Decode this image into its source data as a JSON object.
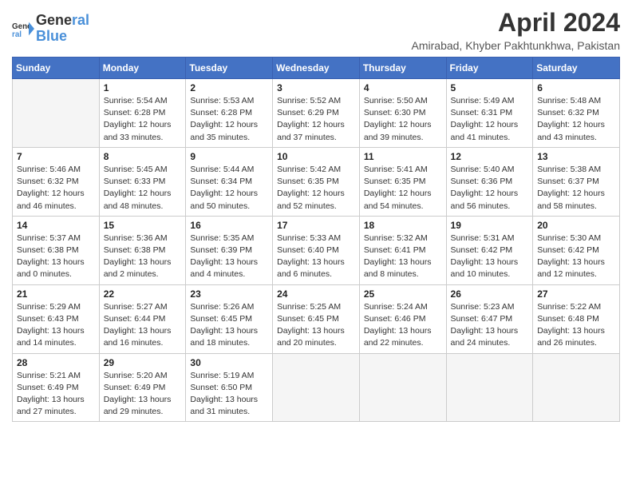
{
  "logo": {
    "line1": "General",
    "line2": "Blue"
  },
  "title": "April 2024",
  "subtitle": "Amirabad, Khyber Pakhtunkhwa, Pakistan",
  "weekdays": [
    "Sunday",
    "Monday",
    "Tuesday",
    "Wednesday",
    "Thursday",
    "Friday",
    "Saturday"
  ],
  "weeks": [
    [
      {
        "day": "",
        "sunrise": "",
        "sunset": "",
        "daylight": ""
      },
      {
        "day": "1",
        "sunrise": "Sunrise: 5:54 AM",
        "sunset": "Sunset: 6:28 PM",
        "daylight": "Daylight: 12 hours and 33 minutes."
      },
      {
        "day": "2",
        "sunrise": "Sunrise: 5:53 AM",
        "sunset": "Sunset: 6:28 PM",
        "daylight": "Daylight: 12 hours and 35 minutes."
      },
      {
        "day": "3",
        "sunrise": "Sunrise: 5:52 AM",
        "sunset": "Sunset: 6:29 PM",
        "daylight": "Daylight: 12 hours and 37 minutes."
      },
      {
        "day": "4",
        "sunrise": "Sunrise: 5:50 AM",
        "sunset": "Sunset: 6:30 PM",
        "daylight": "Daylight: 12 hours and 39 minutes."
      },
      {
        "day": "5",
        "sunrise": "Sunrise: 5:49 AM",
        "sunset": "Sunset: 6:31 PM",
        "daylight": "Daylight: 12 hours and 41 minutes."
      },
      {
        "day": "6",
        "sunrise": "Sunrise: 5:48 AM",
        "sunset": "Sunset: 6:32 PM",
        "daylight": "Daylight: 12 hours and 43 minutes."
      }
    ],
    [
      {
        "day": "7",
        "sunrise": "Sunrise: 5:46 AM",
        "sunset": "Sunset: 6:32 PM",
        "daylight": "Daylight: 12 hours and 46 minutes."
      },
      {
        "day": "8",
        "sunrise": "Sunrise: 5:45 AM",
        "sunset": "Sunset: 6:33 PM",
        "daylight": "Daylight: 12 hours and 48 minutes."
      },
      {
        "day": "9",
        "sunrise": "Sunrise: 5:44 AM",
        "sunset": "Sunset: 6:34 PM",
        "daylight": "Daylight: 12 hours and 50 minutes."
      },
      {
        "day": "10",
        "sunrise": "Sunrise: 5:42 AM",
        "sunset": "Sunset: 6:35 PM",
        "daylight": "Daylight: 12 hours and 52 minutes."
      },
      {
        "day": "11",
        "sunrise": "Sunrise: 5:41 AM",
        "sunset": "Sunset: 6:35 PM",
        "daylight": "Daylight: 12 hours and 54 minutes."
      },
      {
        "day": "12",
        "sunrise": "Sunrise: 5:40 AM",
        "sunset": "Sunset: 6:36 PM",
        "daylight": "Daylight: 12 hours and 56 minutes."
      },
      {
        "day": "13",
        "sunrise": "Sunrise: 5:38 AM",
        "sunset": "Sunset: 6:37 PM",
        "daylight": "Daylight: 12 hours and 58 minutes."
      }
    ],
    [
      {
        "day": "14",
        "sunrise": "Sunrise: 5:37 AM",
        "sunset": "Sunset: 6:38 PM",
        "daylight": "Daylight: 13 hours and 0 minutes."
      },
      {
        "day": "15",
        "sunrise": "Sunrise: 5:36 AM",
        "sunset": "Sunset: 6:38 PM",
        "daylight": "Daylight: 13 hours and 2 minutes."
      },
      {
        "day": "16",
        "sunrise": "Sunrise: 5:35 AM",
        "sunset": "Sunset: 6:39 PM",
        "daylight": "Daylight: 13 hours and 4 minutes."
      },
      {
        "day": "17",
        "sunrise": "Sunrise: 5:33 AM",
        "sunset": "Sunset: 6:40 PM",
        "daylight": "Daylight: 13 hours and 6 minutes."
      },
      {
        "day": "18",
        "sunrise": "Sunrise: 5:32 AM",
        "sunset": "Sunset: 6:41 PM",
        "daylight": "Daylight: 13 hours and 8 minutes."
      },
      {
        "day": "19",
        "sunrise": "Sunrise: 5:31 AM",
        "sunset": "Sunset: 6:42 PM",
        "daylight": "Daylight: 13 hours and 10 minutes."
      },
      {
        "day": "20",
        "sunrise": "Sunrise: 5:30 AM",
        "sunset": "Sunset: 6:42 PM",
        "daylight": "Daylight: 13 hours and 12 minutes."
      }
    ],
    [
      {
        "day": "21",
        "sunrise": "Sunrise: 5:29 AM",
        "sunset": "Sunset: 6:43 PM",
        "daylight": "Daylight: 13 hours and 14 minutes."
      },
      {
        "day": "22",
        "sunrise": "Sunrise: 5:27 AM",
        "sunset": "Sunset: 6:44 PM",
        "daylight": "Daylight: 13 hours and 16 minutes."
      },
      {
        "day": "23",
        "sunrise": "Sunrise: 5:26 AM",
        "sunset": "Sunset: 6:45 PM",
        "daylight": "Daylight: 13 hours and 18 minutes."
      },
      {
        "day": "24",
        "sunrise": "Sunrise: 5:25 AM",
        "sunset": "Sunset: 6:45 PM",
        "daylight": "Daylight: 13 hours and 20 minutes."
      },
      {
        "day": "25",
        "sunrise": "Sunrise: 5:24 AM",
        "sunset": "Sunset: 6:46 PM",
        "daylight": "Daylight: 13 hours and 22 minutes."
      },
      {
        "day": "26",
        "sunrise": "Sunrise: 5:23 AM",
        "sunset": "Sunset: 6:47 PM",
        "daylight": "Daylight: 13 hours and 24 minutes."
      },
      {
        "day": "27",
        "sunrise": "Sunrise: 5:22 AM",
        "sunset": "Sunset: 6:48 PM",
        "daylight": "Daylight: 13 hours and 26 minutes."
      }
    ],
    [
      {
        "day": "28",
        "sunrise": "Sunrise: 5:21 AM",
        "sunset": "Sunset: 6:49 PM",
        "daylight": "Daylight: 13 hours and 27 minutes."
      },
      {
        "day": "29",
        "sunrise": "Sunrise: 5:20 AM",
        "sunset": "Sunset: 6:49 PM",
        "daylight": "Daylight: 13 hours and 29 minutes."
      },
      {
        "day": "30",
        "sunrise": "Sunrise: 5:19 AM",
        "sunset": "Sunset: 6:50 PM",
        "daylight": "Daylight: 13 hours and 31 minutes."
      },
      {
        "day": "",
        "sunrise": "",
        "sunset": "",
        "daylight": ""
      },
      {
        "day": "",
        "sunrise": "",
        "sunset": "",
        "daylight": ""
      },
      {
        "day": "",
        "sunrise": "",
        "sunset": "",
        "daylight": ""
      },
      {
        "day": "",
        "sunrise": "",
        "sunset": "",
        "daylight": ""
      }
    ]
  ]
}
